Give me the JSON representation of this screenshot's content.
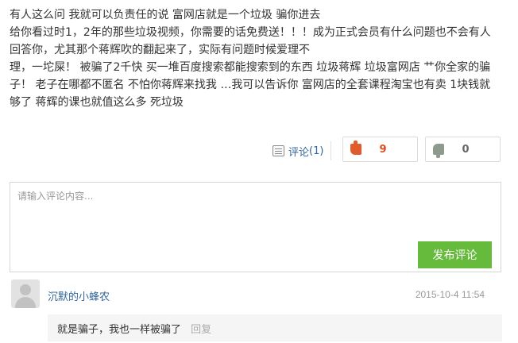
{
  "post": {
    "lines": [
      "有人这么问 我就可以负责任的说 富网店就是一个垃圾 骗你进去",
      "给你看过时1，2年的那些垃圾视频，你需要的话免费送！！！成为正式会员有什么问题也不会有人",
      "回答你，尤其那个蒋辉吹的翻起来了，实际有问题时候爱理不",
      "理，一坨屎！ 被骗了2千快 买一堆百度搜索都能搜索到的东西 垃圾蒋辉 垃圾富网店 艹你全家的骗",
      "子！ 老子在哪都不匿名 不怕你蒋辉来找我 …我可以告诉你 富网店的全套课程淘宝也有卖 1块钱就",
      "够了 蒋辉的课也就值这么多 死垃圾"
    ]
  },
  "actions": {
    "comment_label": "评论",
    "comment_count": "(1)",
    "upvotes": "9",
    "downvotes": "0",
    "icons": {
      "comment": "comment-icon",
      "upvote": "thumbs-up-icon",
      "downvote": "thumbs-down-icon"
    }
  },
  "comment_form": {
    "placeholder": "请输入评论内容...",
    "submit_label": "发布评论",
    "accent_color": "#66bb3c"
  },
  "replies": [
    {
      "username": "沉默的小蜂农",
      "time": "2015-10-4 11:54",
      "text": "就是骗子，我也一样被骗了",
      "reply_label": "回复"
    }
  ]
}
